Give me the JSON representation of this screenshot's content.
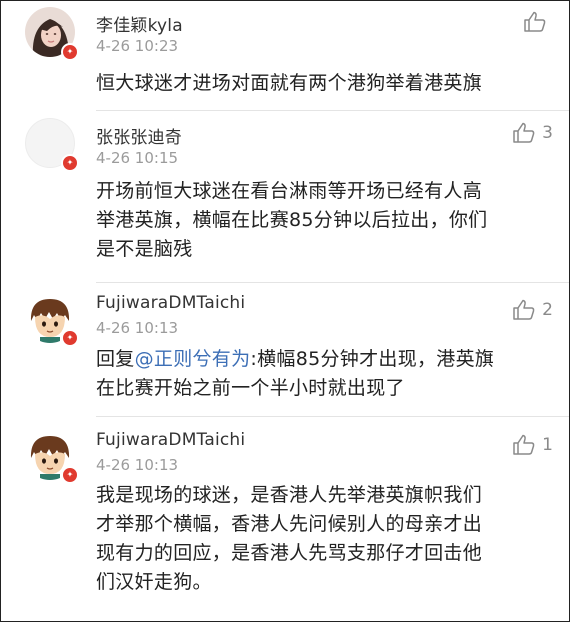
{
  "comments": [
    {
      "username": "李佳颖kyla",
      "time": "4-26 10:23",
      "likes": "",
      "avatar": "girl-photo",
      "badge": "flag-badge-icon",
      "text_lines": [
        "恒大球迷才进场对面就有两个港狗举着港英旗"
      ]
    },
    {
      "username": "张张张迪奇",
      "time": "4-26 10:15",
      "likes": "3",
      "avatar": "blank",
      "badge": "flag-badge-icon",
      "text_lines": [
        "开场前恒大球迷在看台淋雨等开场已经有人高",
        "举港英旗，横幅在比赛85分钟以后拉出，你们",
        "是不是脑残"
      ]
    },
    {
      "username": "FujiwaraDMTaichi",
      "time": "4-26 10:13",
      "likes": "2",
      "avatar": "cartoon-boy",
      "badge": "flag-badge-icon",
      "reply_prefix": "回复",
      "mention": "@正则兮有为",
      "reply_rest": ":横幅85分钟才出现，港英旗",
      "text_lines": [
        "在比赛开始之前一个半小时就出现了"
      ]
    },
    {
      "username": "FujiwaraDMTaichi",
      "time": "4-26 10:13",
      "likes": "1",
      "avatar": "cartoon-boy",
      "badge": "flag-badge-icon",
      "text_lines": [
        "我是现场的球迷，是香港人先举港英旗帜我们",
        "才举那个横幅，香港人先问候别人的母亲才出",
        "现有力的回应，是香港人先骂支那仔才回击他",
        "们汉奸走狗。"
      ]
    }
  ]
}
